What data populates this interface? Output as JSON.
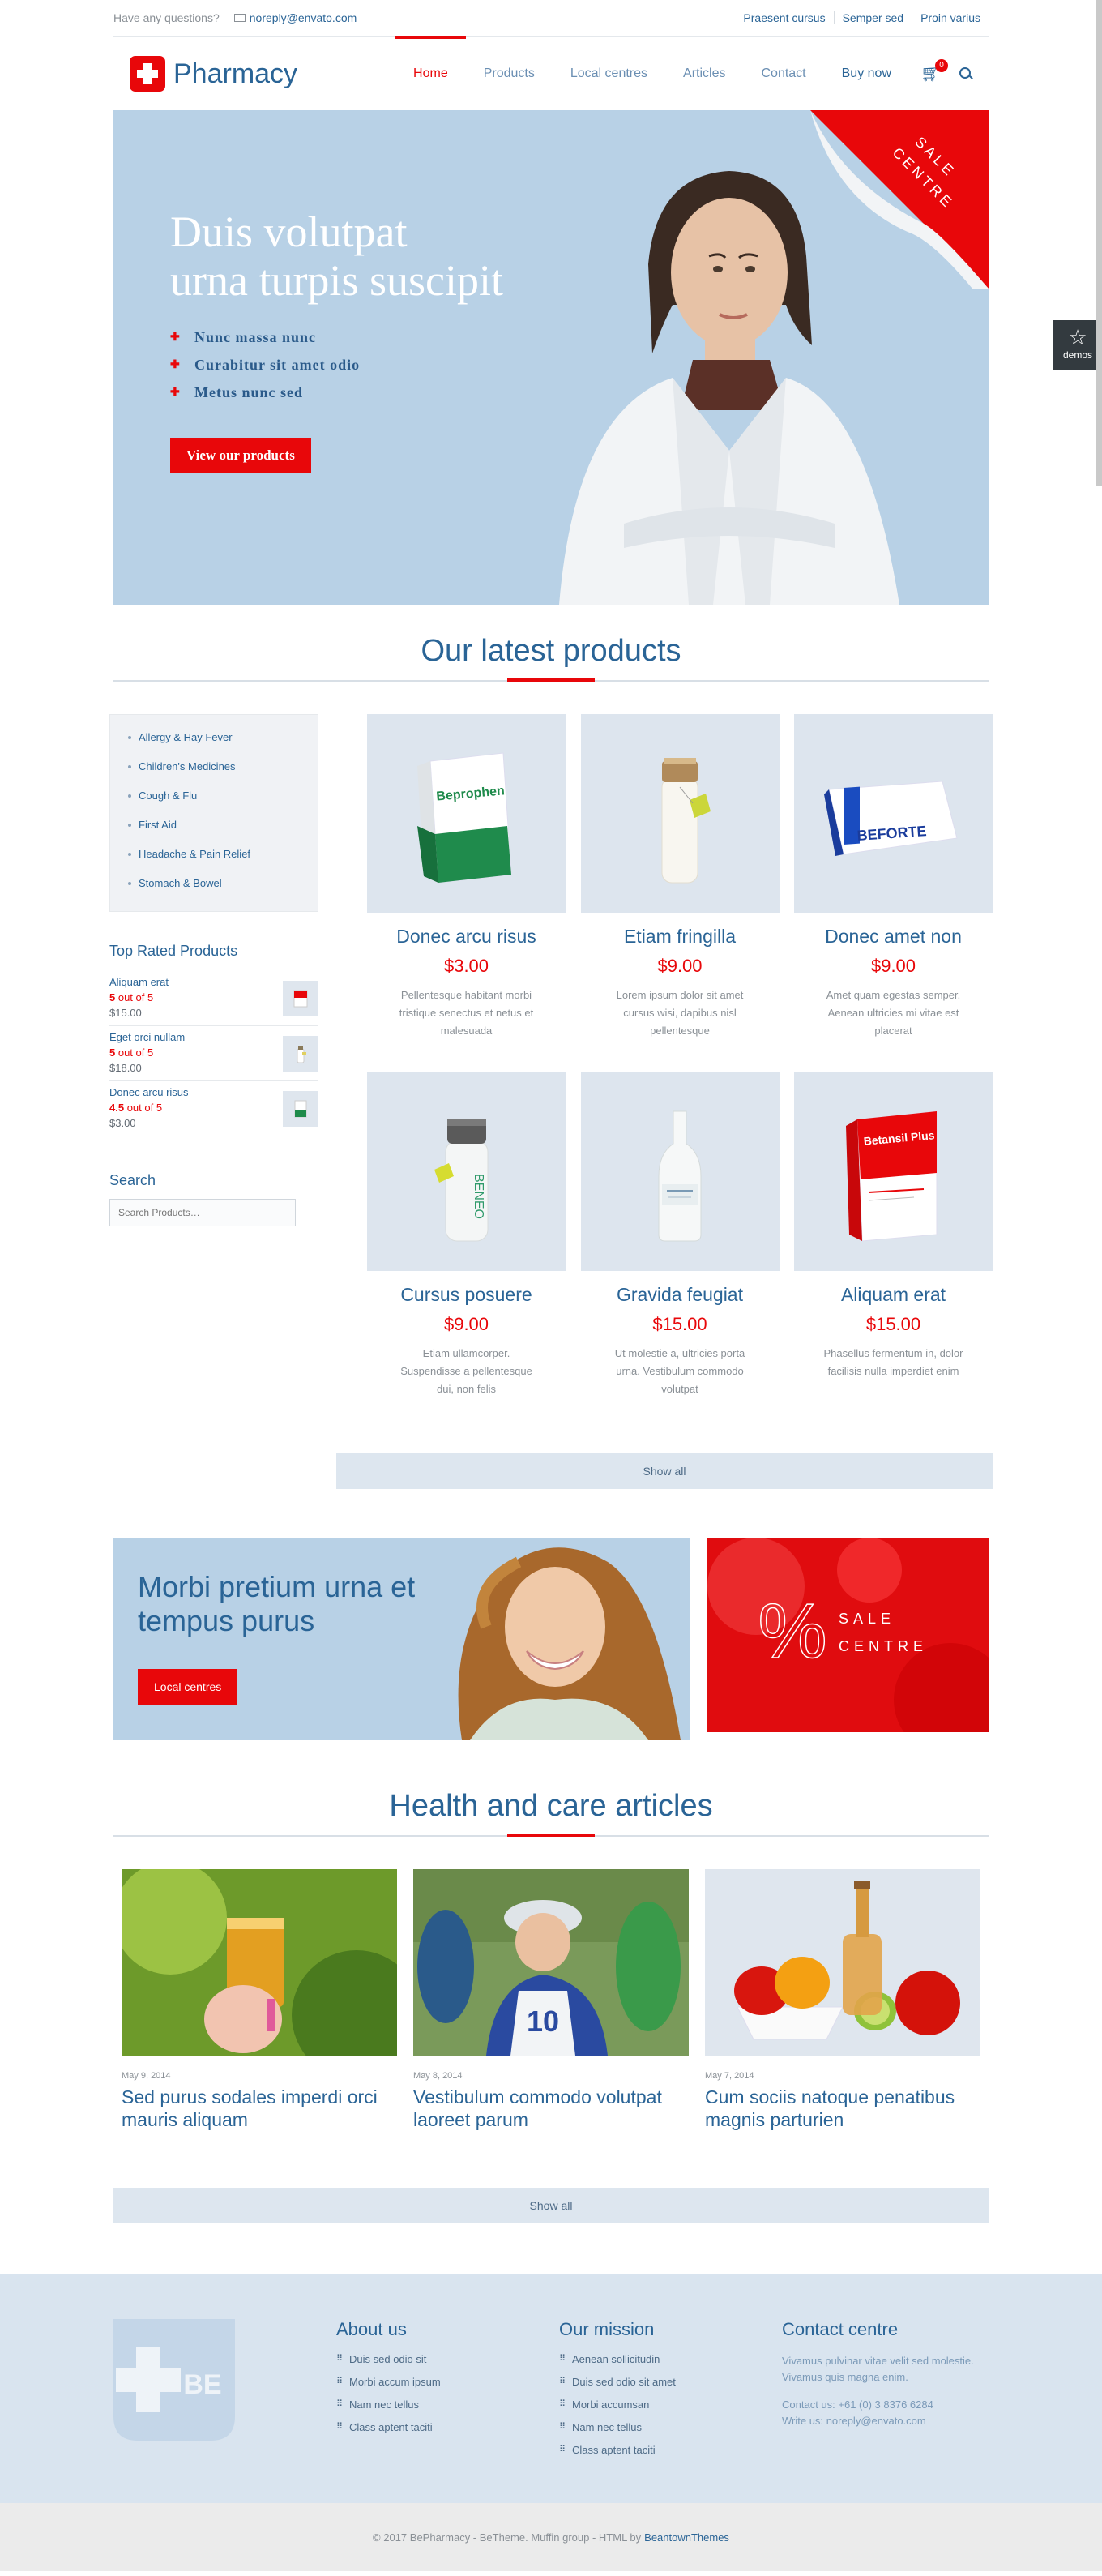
{
  "topbar": {
    "question": "Have any questions?",
    "email": "noreply@envato.com",
    "links": [
      "Praesent cursus",
      "Semper sed",
      "Proin varius"
    ]
  },
  "header": {
    "logo_text": "Pharmacy",
    "nav": [
      "Home",
      "Products",
      "Local centres",
      "Articles",
      "Contact",
      "Buy now"
    ],
    "cart_count": "0"
  },
  "hero": {
    "title_line1": "Duis volutpat",
    "title_line2": "urna turpis suscipit",
    "bullets": [
      "Nunc massa nunc",
      "Curabitur sit amet odio",
      "Metus nunc sed"
    ],
    "button": "View our products",
    "corner_line1": "SALE",
    "corner_line2": "CENTRE"
  },
  "demos_label": "demos",
  "products_section": {
    "title": "Our latest products",
    "categories": [
      "Allergy & Hay Fever",
      "Children's Medicines",
      "Cough & Flu",
      "First Aid",
      "Headache & Pain Relief",
      "Stomach & Bowel"
    ],
    "top_rated_title": "Top Rated Products",
    "top_rated": [
      {
        "name": "Aliquam erat",
        "rating": "5",
        "rating_suffix": " out of 5",
        "price": "$15.00"
      },
      {
        "name": "Eget orci nullam",
        "rating": "5",
        "rating_suffix": " out of 5",
        "price": "$18.00"
      },
      {
        "name": "Donec arcu risus",
        "rating": "4.5",
        "rating_suffix": " out of 5",
        "price": "$3.00"
      }
    ],
    "search_title": "Search",
    "search_placeholder": "Search Products…",
    "products": [
      {
        "name": "Donec arcu risus",
        "price": "$3.00",
        "desc": "Pellentesque habitant morbi tristique senectus et netus et malesuada",
        "box_label": "Beprophen"
      },
      {
        "name": "Etiam fringilla",
        "price": "$9.00",
        "desc": "Lorem ipsum dolor sit amet cursus wisi, dapibus nisl pellentesque"
      },
      {
        "name": "Donec amet non",
        "price": "$9.00",
        "desc": "Amet quam egestas semper. Aenean ultricies mi vitae est placerat",
        "box_label": "BEFORTE"
      },
      {
        "name": "Cursus posuere",
        "price": "$9.00",
        "desc": "Etiam ullamcorper. Suspendisse a pellentesque dui, non felis",
        "box_label": "BENEO"
      },
      {
        "name": "Gravida feugiat",
        "price": "$15.00",
        "desc": "Ut molestie a, ultricies porta urna. Vestibulum commodo volutpat"
      },
      {
        "name": "Aliquam erat",
        "price": "$15.00",
        "desc": "Phasellus fermentum in, dolor facilisis nulla imperdiet enim",
        "box_label": "Betansil Plus"
      }
    ],
    "show_all": "Show all"
  },
  "banners": {
    "left_title_line1": "Morbi pretium urna et",
    "left_title_line2": "tempus purus",
    "left_button": "Local centres",
    "right_symbol": "%",
    "right_line1": "SALE",
    "right_line2": "CENTRE"
  },
  "articles_section": {
    "title": "Health and care articles",
    "articles": [
      {
        "date": "May 9, 2014",
        "title": "Sed purus sodales imperdi orci mauris aliquam"
      },
      {
        "date": "May 8, 2014",
        "title": "Vestibulum commodo volutpat laoreet parum"
      },
      {
        "date": "May 7, 2014",
        "title": "Cum sociis natoque penatibus magnis parturien"
      }
    ],
    "show_all": "Show all"
  },
  "footer": {
    "logo_text": "BE",
    "about_title": "About us",
    "about_links": [
      "Duis sed odio sit",
      "Morbi accum ipsum",
      "Nam nec tellus",
      "Class aptent taciti"
    ],
    "mission_title": "Our mission",
    "mission_links": [
      "Aenean sollicitudin",
      "Duis sed odio sit amet",
      "Morbi accumsan",
      "Nam nec tellus",
      "Class aptent taciti"
    ],
    "contact_title": "Contact centre",
    "contact_text": "Vivamus pulvinar vitae velit sed molestie. Vivamus quis magna enim.",
    "contact_phone": "Contact us: +61 (0) 3 8376 6284",
    "contact_write": "Write us:",
    "contact_email": "noreply@envato.com",
    "copyright": "© 2017 BePharmacy - BeTheme. Muffin group - HTML by",
    "copyright_link": "BeantownThemes"
  }
}
